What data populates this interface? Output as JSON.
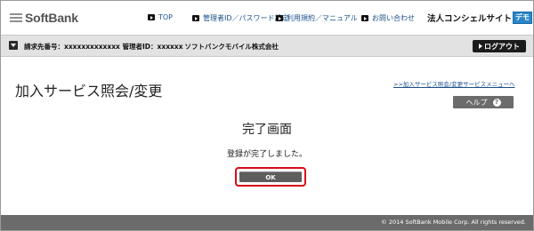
{
  "header": {
    "logo_text": "SoftBank",
    "nav": [
      {
        "label": "TOP"
      },
      {
        "label": "管理者ID／パスワード設定"
      },
      {
        "label": "利用規約／マニュアル"
      },
      {
        "label": "お問い合わせ"
      }
    ],
    "site_name": "法人コンシェルサイト",
    "demo_badge": "デモ"
  },
  "account_bar": {
    "info": "請求先番号：xxxxxxxxxxxxx 管理者ID：xxxxxx",
    "company": "ソフトバンクモバイル株式会社",
    "logout_label": "ログアウト"
  },
  "main": {
    "page_title": "加入サービス照会/変更",
    "menu_link": ">>加入サービス照会/変更サービスメニューへ",
    "help_label": "ヘルプ",
    "help_icon": "?",
    "complete_title": "完了画面",
    "complete_message": "登録が完了しました。",
    "ok_label": "OK"
  },
  "footer": {
    "copyright": "© 2014 SoftBank Mobile Corp. All rights reserved."
  },
  "colors": {
    "highlight": "#d80c18",
    "link": "#1a4f8a",
    "demo_badge": "#2a86c8",
    "footer": "#6b6b6b"
  }
}
